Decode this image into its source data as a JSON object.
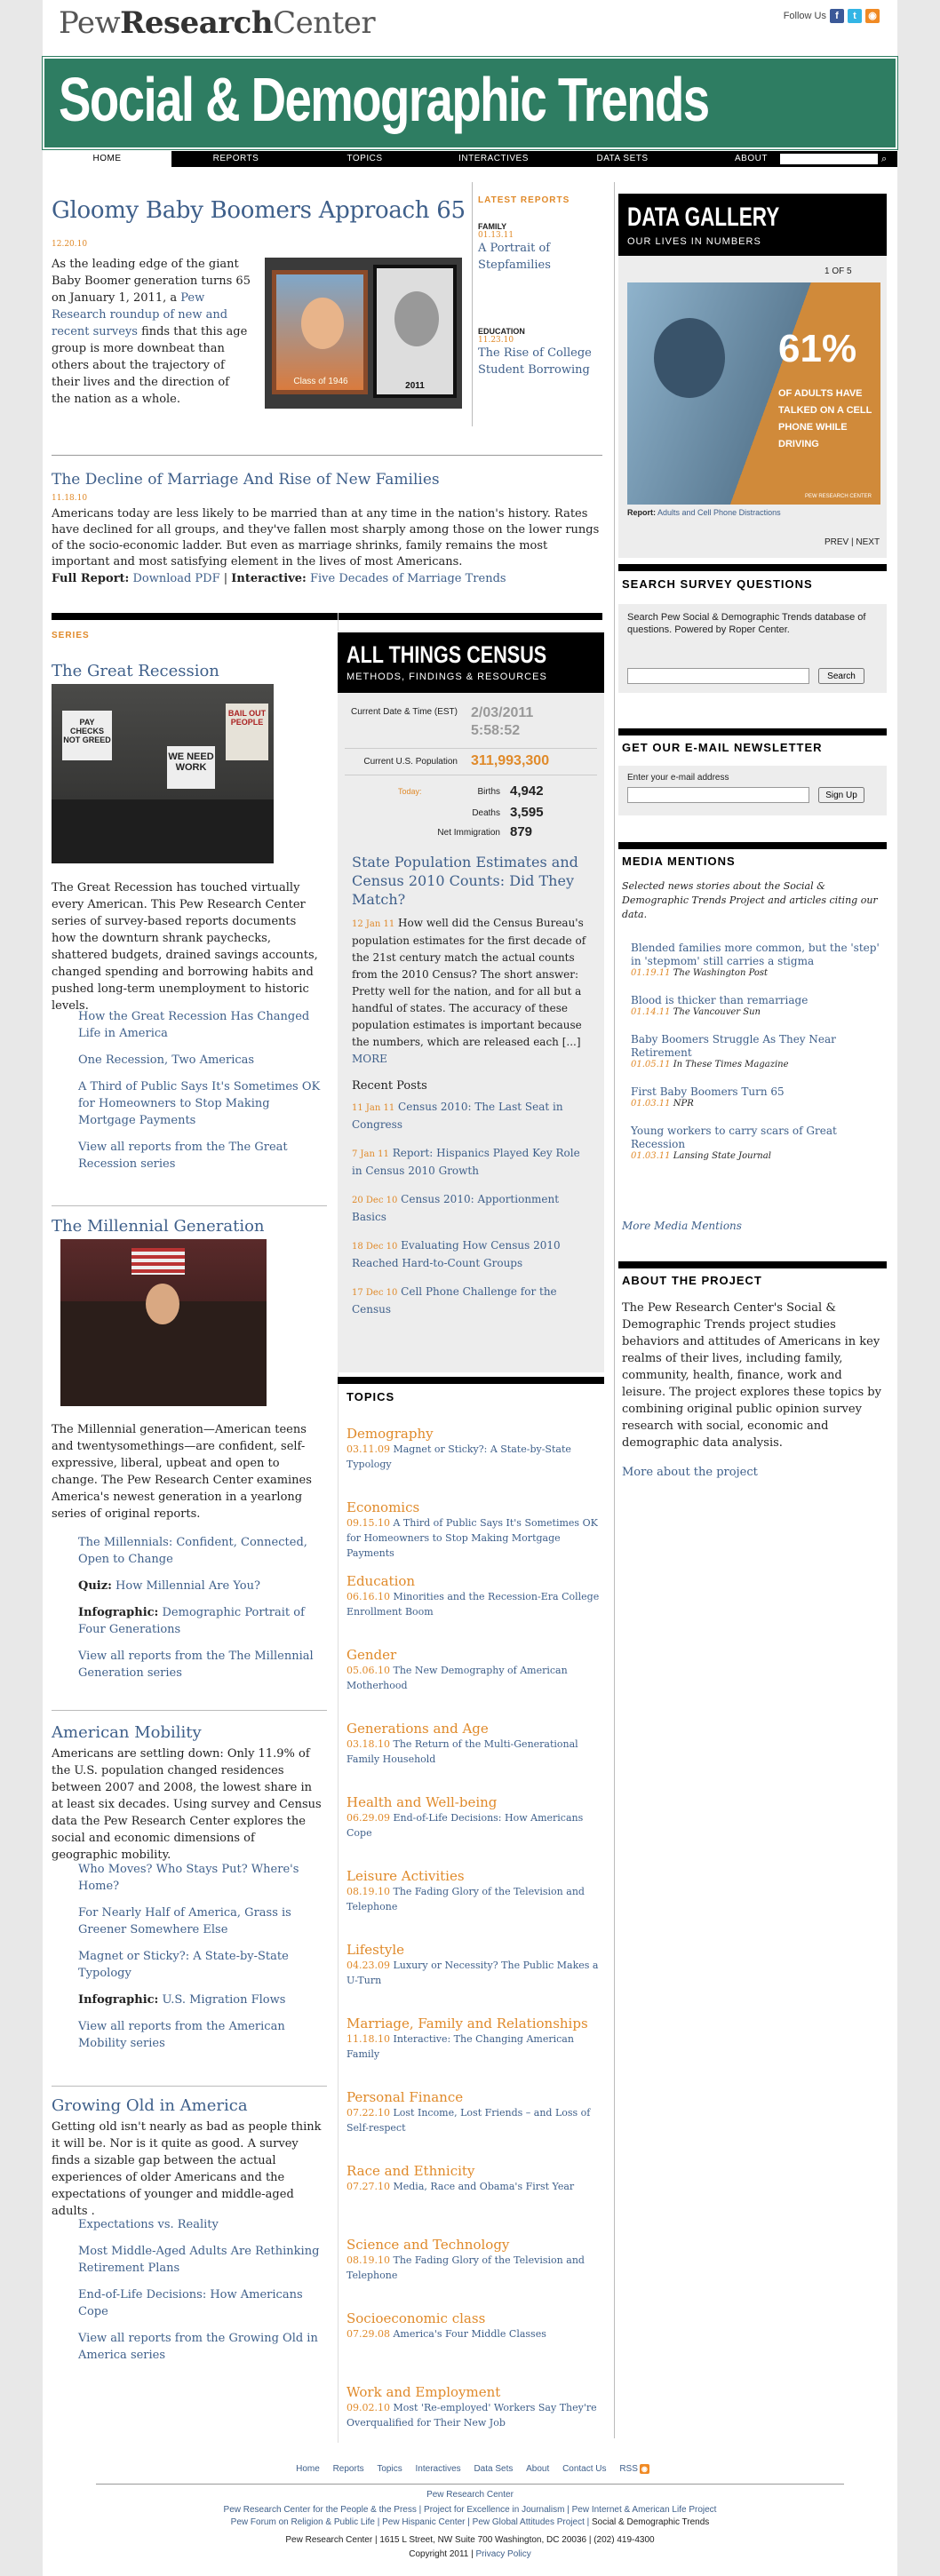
{
  "header": {
    "logo_light": "Pew",
    "logo_bold": "Research",
    "logo_rest": "Center",
    "follow_us": "Follow Us",
    "banner_title": "Social & Demographic Trends"
  },
  "nav": {
    "items": [
      "HOME",
      "REPORTS",
      "TOPICS",
      "INTERACTIVES",
      "DATA SETS",
      "ABOUT"
    ]
  },
  "lead": {
    "title": "Gloomy Baby Boomers Approach 65",
    "date": "12.20.10",
    "text_before": "As the leading edge of the giant Baby Boomer generation turns 65 on January 1, 2011, a ",
    "link": "Pew Research roundup of new and recent surveys",
    "text_after": " finds that this age group is more downbeat than others about the trajectory of their lives and the direction of the nation as a whole.",
    "img_caption_left": "Class of 1946",
    "img_caption_right": "2011"
  },
  "latest": {
    "heading": "LATEST REPORTS",
    "items": [
      {
        "category": "FAMILY",
        "date": "01.13.11",
        "title": "A Portrait of Stepfamilies"
      },
      {
        "category": "EDUCATION",
        "date": "11.23.10",
        "title": "The Rise of College Student Borrowing"
      }
    ]
  },
  "feature2": {
    "title": "The Decline of Marriage And Rise of New Families",
    "date": "11.18.10",
    "text": "Americans today are less likely to be married than at any time in the nation's history. Rates have declined for all groups, and they've fallen most sharply among those on the lower rungs of the socio-economic ladder. But even as marriage shrinks, family remains the most important and most satisfying element in the lives of most Americans.",
    "full_report_label": "Full Report:",
    "full_report_link": "Download PDF",
    "interactive_label": "Interactive:",
    "interactive_link": "Five Decades of Marriage Trends"
  },
  "series": {
    "heading": "SERIES",
    "recession": {
      "title": "The Great Recession",
      "text": "The Great Recession has touched virtually every American. This Pew Research Center series of survey-based reports documents how the downturn shrank paychecks, shattered budgets, drained savings accounts, changed spending and borrowing habits and pushed long-term unemployment to historic levels.",
      "links": [
        "How the Great Recession Has Changed Life in America",
        "One Recession, Two Americas",
        "A Third of Public Says It's Sometimes OK for Homeowners to Stop Making Mortgage Payments",
        "View all reports from the The Great Recession series"
      ],
      "signs": [
        "PAY CHECKS NOT GREED",
        "WE NEED WORK",
        "BAIL OUT PEOPLE"
      ]
    },
    "millennial": {
      "title": "The Millennial Generation",
      "text": "The Millennial generation—American teens and twentysomethings—are confident, self-expressive, liberal, upbeat and open to change. The Pew Research Center examines America's newest generation in a yearlong series of original reports.",
      "link1": "The Millennials: Confident, Connected, Open to Change",
      "quiz_label": "Quiz:",
      "quiz_link": "How Millennial Are You?",
      "info_label": "Infographic:",
      "info_link": "Demographic Portrait of Four Generations",
      "link_all": "View all reports from the The Millennial Generation series"
    },
    "mobility": {
      "title": "American Mobility",
      "text": "Americans are settling down: Only 11.9% of the U.S. population changed residences between 2007 and 2008, the lowest share in at least six decades. Using survey and Census data the Pew Research Center explores the social and economic dimensions of geographic mobility.",
      "links": [
        "Who Moves? Who Stays Put? Where's Home?",
        "For Nearly Half of America, Grass is Greener Somewhere Else",
        "Magnet or Sticky?: A State-by-State Typology"
      ],
      "info_label": "Infographic:",
      "info_link": "U.S. Migration Flows",
      "link_all": "View all reports from the American Mobility series"
    },
    "growingold": {
      "title": "Growing Old in America",
      "text": "Getting old isn't nearly as bad as people think it will be. Nor is it quite as good. A survey finds a sizable gap between the actual experiences of older Americans and the expectations of younger and middle-aged adults .",
      "links": [
        "Expectations vs. Reality",
        "Most Middle-Aged Adults Are Rethinking Retirement Plans",
        "End-of-Life Decisions: How Americans Cope",
        "View all reports from the Growing Old in America series"
      ]
    }
  },
  "census": {
    "title": "ALL THINGS CENSUS",
    "subtitle": "METHODS, FINDINGS & RESOURCES",
    "current_label": "Current Date & Time (EST)",
    "date": "2/03/2011",
    "time": "5:58:52",
    "pop_label": "Current U.S. Population",
    "population": "311,993,300",
    "today_label": "Today:",
    "births_label": "Births",
    "births": "4,942",
    "deaths_label": "Deaths",
    "deaths": "3,595",
    "imm_label": "Net Immigration",
    "immigration": "879",
    "post_title": "State Population Estimates and Census 2010 Counts: Did They Match?",
    "post_date": "12 Jan 11",
    "post_text": "How well did the Census Bureau's population estimates for the first decade of the 21st century match the actual counts from the 2010 Census? The short answer: Pretty well for the nation, and for all but a handful of states. The accuracy of these population estimates is important because the numbers, which are released each [...]",
    "more": "MORE",
    "recent_heading": "Recent Posts",
    "recent": [
      {
        "date": "11 Jan 11",
        "title": "Census 2010: The Last Seat in Congress"
      },
      {
        "date": "7 Jan 11",
        "title": "Report: Hispanics Played Key Role in Census 2010 Growth"
      },
      {
        "date": "20 Dec 10",
        "title": "Census 2010: Apportionment Basics"
      },
      {
        "date": "18 Dec 10",
        "title": "Evaluating How Census 2010 Reached Hard-to-Count Groups"
      },
      {
        "date": "17 Dec 10",
        "title": "Cell Phone Challenge for the Census"
      }
    ]
  },
  "topics": {
    "heading": "TOPICS",
    "items": [
      {
        "name": "Demography",
        "date": "03.11.09",
        "link": "Magnet or Sticky?: A State-by-State Typology"
      },
      {
        "name": "Economics",
        "date": "09.15.10",
        "link": "A Third of Public Says It's Sometimes OK for Homeowners to Stop Making Mortgage Payments"
      },
      {
        "name": "Education",
        "date": "06.16.10",
        "link": "Minorities and the Recession-Era College Enrollment Boom"
      },
      {
        "name": "Gender",
        "date": "05.06.10",
        "link": "The New Demography of American Motherhood"
      },
      {
        "name": "Generations and Age",
        "date": "03.18.10",
        "link": "The Return of the Multi-Generational Family Household"
      },
      {
        "name": "Health and Well-being",
        "date": "06.29.09",
        "link": "End-of-Life Decisions: How Americans Cope"
      },
      {
        "name": "Leisure Activities",
        "date": "08.19.10",
        "link": "The Fading Glory of the Television and Telephone"
      },
      {
        "name": "Lifestyle",
        "date": "04.23.09",
        "link": "Luxury or Necessity? The Public Makes a U-Turn"
      },
      {
        "name": "Marriage, Family and Relationships",
        "date": "11.18.10",
        "link": "Interactive: The Changing American Family"
      },
      {
        "name": "Personal Finance",
        "date": "07.22.10",
        "link": "Lost Income, Lost Friends – and Loss of Self-respect"
      },
      {
        "name": "Race and Ethnicity",
        "date": "07.27.10",
        "link": "Media, Race and Obama's First Year"
      },
      {
        "name": "Science and Technology",
        "date": "08.19.10",
        "link": "The Fading Glory of the Television and Telephone"
      },
      {
        "name": "Socioeconomic class",
        "date": "07.29.08",
        "link": "America's Four Middle Classes"
      },
      {
        "name": "Work and Employment",
        "date": "09.02.10",
        "link": "Most 'Re-employed' Workers Say They're Overqualified for Their New Job"
      }
    ]
  },
  "gallery": {
    "title": "DATA GALLERY",
    "subtitle": "OUR LIVES IN NUMBERS",
    "counter": "1 OF 5",
    "stat": "61%",
    "stat_text": "OF ADULTS HAVE TALKED ON A CELL PHONE WHILE DRIVING",
    "credit": "PEW RESEARCH CENTER",
    "report_label": "Report:",
    "report_text": "Adults and Cell Phone Distractions",
    "prev": "PREV",
    "next": "NEXT"
  },
  "survey": {
    "heading": "SEARCH SURVEY QUESTIONS",
    "text": "Search Pew Social & Demographic Trends database of questions. Powered by Roper Center.",
    "button": "Search"
  },
  "newsletter": {
    "heading": "GET OUR E-MAIL NEWSLETTER",
    "label": "Enter your e-mail address",
    "button": "Sign Up"
  },
  "media": {
    "heading": "MEDIA MENTIONS",
    "intro": "Selected news stories about the Social & Demographic Trends Project and articles citing our data.",
    "items": [
      {
        "title": "Blended families more common, but the 'step' in 'stepmom' still carries a stigma",
        "date": "01.19.11",
        "source": "The Washington Post"
      },
      {
        "title": "Blood is thicker than remarriage",
        "date": "01.14.11",
        "source": "The Vancouver Sun"
      },
      {
        "title": "Baby Boomers Struggle As They Near Retirement",
        "date": "01.05.11",
        "source": "In These Times Magazine"
      },
      {
        "title": "First Baby Boomers Turn 65",
        "date": "01.03.11",
        "source": "NPR"
      },
      {
        "title": "Young workers to carry scars of Great Recession",
        "date": "01.03.11",
        "source": "Lansing State Journal"
      }
    ],
    "more": "More Media Mentions"
  },
  "about": {
    "heading": "ABOUT THE PROJECT",
    "text": "The Pew Research Center's Social & Demographic Trends project studies behaviors and attitudes of Americans in key realms of their lives, including family, community, health, finance, work and leisure. The project explores these topics by combining original public opinion survey research with social, economic and demographic data analysis.",
    "link": "More about the project"
  },
  "footer": {
    "nav": [
      "Home",
      "Reports",
      "Topics",
      "Interactives",
      "Data Sets",
      "About",
      "Contact Us",
      "RSS"
    ],
    "org": "Pew Research Center",
    "projects1": [
      "Pew Research Center for the People & the Press",
      "Project for Excellence in Journalism",
      "Pew Internet & American Life Project"
    ],
    "projects2": [
      "Pew Forum on Religion & Public Life",
      "Pew Hispanic Center",
      "Pew Global Attitudes Project",
      "Social & Demographic Trends"
    ],
    "address": "Pew Research Center | 1615 L Street, NW Suite 700 Washington, DC 20036 | (202) 419-4300",
    "copyright": "Copyright 2011",
    "privacy": "Privacy Policy"
  },
  "colors": {
    "brand_green": "#2e7d62",
    "accent_orange": "#e08a2a",
    "link_blue": "#3e5f8a"
  }
}
